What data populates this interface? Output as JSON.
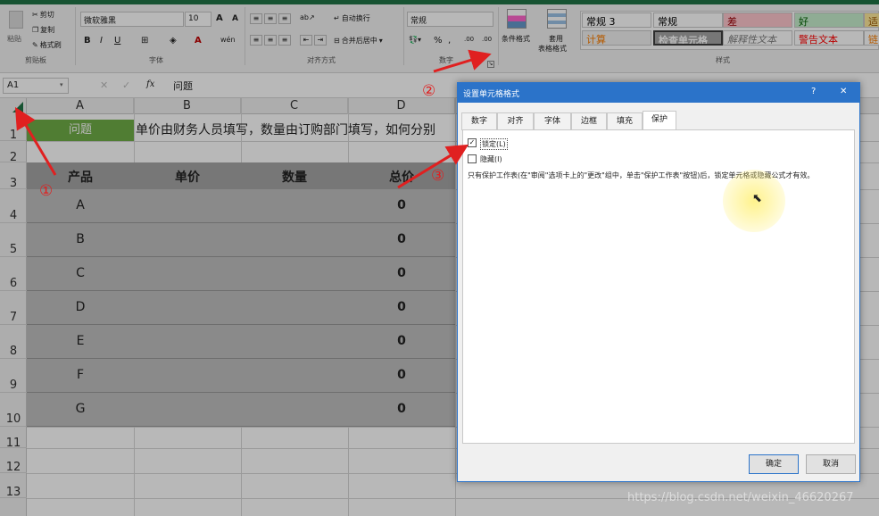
{
  "ribbon": {
    "clipboard": {
      "group_label": "剪贴板",
      "paste": "粘贴",
      "cut": "剪切",
      "copy": "复制",
      "format_painter": "格式刷"
    },
    "font": {
      "group_label": "字体",
      "name": "微软雅黑",
      "size": "10",
      "grow": "A",
      "shrink": "A",
      "bold": "B",
      "italic": "I",
      "underline": "U",
      "font_color": "A",
      "phonetic": "wén"
    },
    "alignment": {
      "group_label": "对齐方式",
      "wrap_text": "自动换行",
      "merge_center": "合并后居中"
    },
    "number": {
      "group_label": "数字",
      "format": "常规",
      "percent": "%",
      "comma": ",",
      "inc_decimal": ".00",
      "dec_decimal": ".00"
    },
    "styles": {
      "group_label": "样式",
      "conditional": "条件格式",
      "format_table_line1": "套用",
      "format_table_line2": "表格格式",
      "cells": [
        {
          "label": "常规 3",
          "bg": "#ffffff",
          "color": "#000000"
        },
        {
          "label": "常规",
          "bg": "#ffffff",
          "color": "#000000"
        },
        {
          "label": "差",
          "bg": "#ffc7ce",
          "color": "#9c0006"
        },
        {
          "label": "好",
          "bg": "#c6efce",
          "color": "#006100"
        },
        {
          "label": "适",
          "bg": "#ffeb9c",
          "color": "#9c5700"
        },
        {
          "label": "计算",
          "bg": "#f2f2f2",
          "color": "#fa7d00"
        },
        {
          "label": "检查单元格",
          "bg": "#a5a5a5",
          "color": "#ffffff"
        },
        {
          "label": "解释性文本",
          "bg": "#ffffff",
          "color": "#7f7f7f"
        },
        {
          "label": "警告文本",
          "bg": "#ffffff",
          "color": "#ff0000"
        },
        {
          "label": "链",
          "bg": "#ffffff",
          "color": "#fa7d00"
        }
      ]
    }
  },
  "formula_bar": {
    "name_box": "A1",
    "fx": "fx",
    "content": "问题"
  },
  "grid": {
    "columns": [
      "A",
      "B",
      "C",
      "D"
    ],
    "rows": [
      "1",
      "2",
      "3",
      "4",
      "5",
      "6",
      "7",
      "8",
      "9",
      "10",
      "11",
      "12",
      "13"
    ],
    "a1_label": "问题",
    "row1_note": "单价由财务人员填写，数量由订购部门填写，如何分别",
    "table_headers": [
      "产品",
      "单价",
      "数量",
      "总价"
    ],
    "products": [
      "A",
      "B",
      "C",
      "D",
      "E",
      "F",
      "G"
    ],
    "totals": [
      "0",
      "0",
      "0",
      "0",
      "0",
      "0",
      "0"
    ]
  },
  "dialog": {
    "title": "设置单元格格式",
    "help": "?",
    "close": "✕",
    "tabs": [
      "数字",
      "对齐",
      "字体",
      "边框",
      "填充",
      "保护"
    ],
    "active_tab": "保护",
    "locked_label": "锁定(L)",
    "locked_checked": true,
    "hidden_label": "隐藏(I)",
    "hidden_checked": false,
    "info": "只有保护工作表(在\"审阅\"选项卡上的\"更改\"组中，单击\"保护工作表\"按钮)后，锁定单元格或隐藏公式才有效。",
    "ok": "确定",
    "cancel": "取消"
  },
  "annotations": {
    "marker1": "①",
    "marker2": "②",
    "marker3": "③"
  },
  "watermark": "https://blog.csdn.net/weixin_46620267",
  "colors": {
    "a1_fill": "#70ad47",
    "dialog_title_bar": "#2b73c9",
    "arrow": "#e02020",
    "header_fill": "#a6a6a6"
  }
}
